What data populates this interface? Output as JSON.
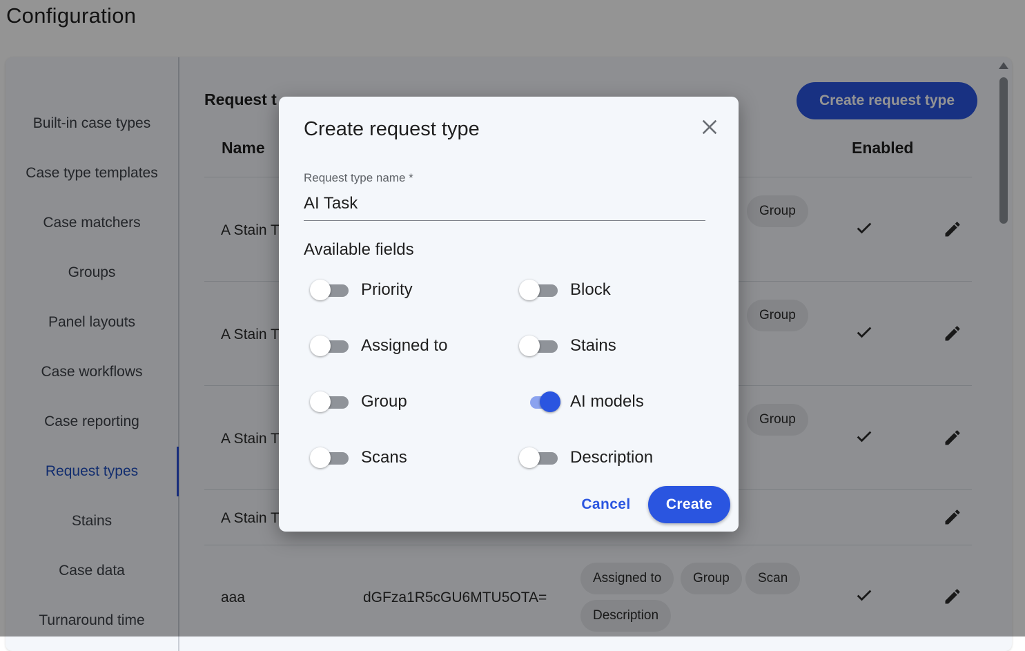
{
  "page": {
    "title": "Configuration"
  },
  "sidebar": {
    "items": [
      {
        "label": "Built-in case types"
      },
      {
        "label": "Case type templates"
      },
      {
        "label": "Case matchers"
      },
      {
        "label": "Groups"
      },
      {
        "label": "Panel layouts"
      },
      {
        "label": "Case workflows"
      },
      {
        "label": "Case reporting"
      },
      {
        "label": "Request types",
        "active": true
      },
      {
        "label": "Stains"
      },
      {
        "label": "Case data"
      },
      {
        "label": "Turnaround time"
      }
    ]
  },
  "main": {
    "section_title": "Request t",
    "create_button": "Create request type",
    "columns": {
      "name": "Name",
      "enabled": "Enabled"
    },
    "rows": [
      {
        "name": "A Stain T",
        "chips": [
          "Group"
        ],
        "enabled": true
      },
      {
        "name": "A Stain T",
        "chips": [
          "Group"
        ],
        "enabled": true
      },
      {
        "name": "A Stain T",
        "chips": [
          "Group"
        ],
        "enabled": true
      },
      {
        "name": "A Stain T",
        "chips": [],
        "enabled": false
      },
      {
        "name": "aaa",
        "code": "dGFza1R5cGU6MTU5OTA=",
        "chips": [
          "Assigned to",
          "Group",
          "Scan",
          "Description"
        ],
        "enabled": true
      }
    ]
  },
  "dialog": {
    "title": "Create request type",
    "name_label": "Request type name *",
    "name_value": "AI Task",
    "available_fields_label": "Available fields",
    "fields": [
      {
        "label": "Priority",
        "on": false
      },
      {
        "label": "Block",
        "on": false
      },
      {
        "label": "Assigned to",
        "on": false
      },
      {
        "label": "Stains",
        "on": false
      },
      {
        "label": "Group",
        "on": false
      },
      {
        "label": "AI models",
        "on": true
      },
      {
        "label": "Scans",
        "on": false
      },
      {
        "label": "Description",
        "on": false
      }
    ],
    "cancel_label": "Cancel",
    "create_label": "Create"
  },
  "colors": {
    "accent": "#2a55e0",
    "active_nav": "#1f4fbf"
  },
  "icons": {
    "close": "close-icon",
    "check": "check-icon",
    "edit": "pencil-icon"
  }
}
